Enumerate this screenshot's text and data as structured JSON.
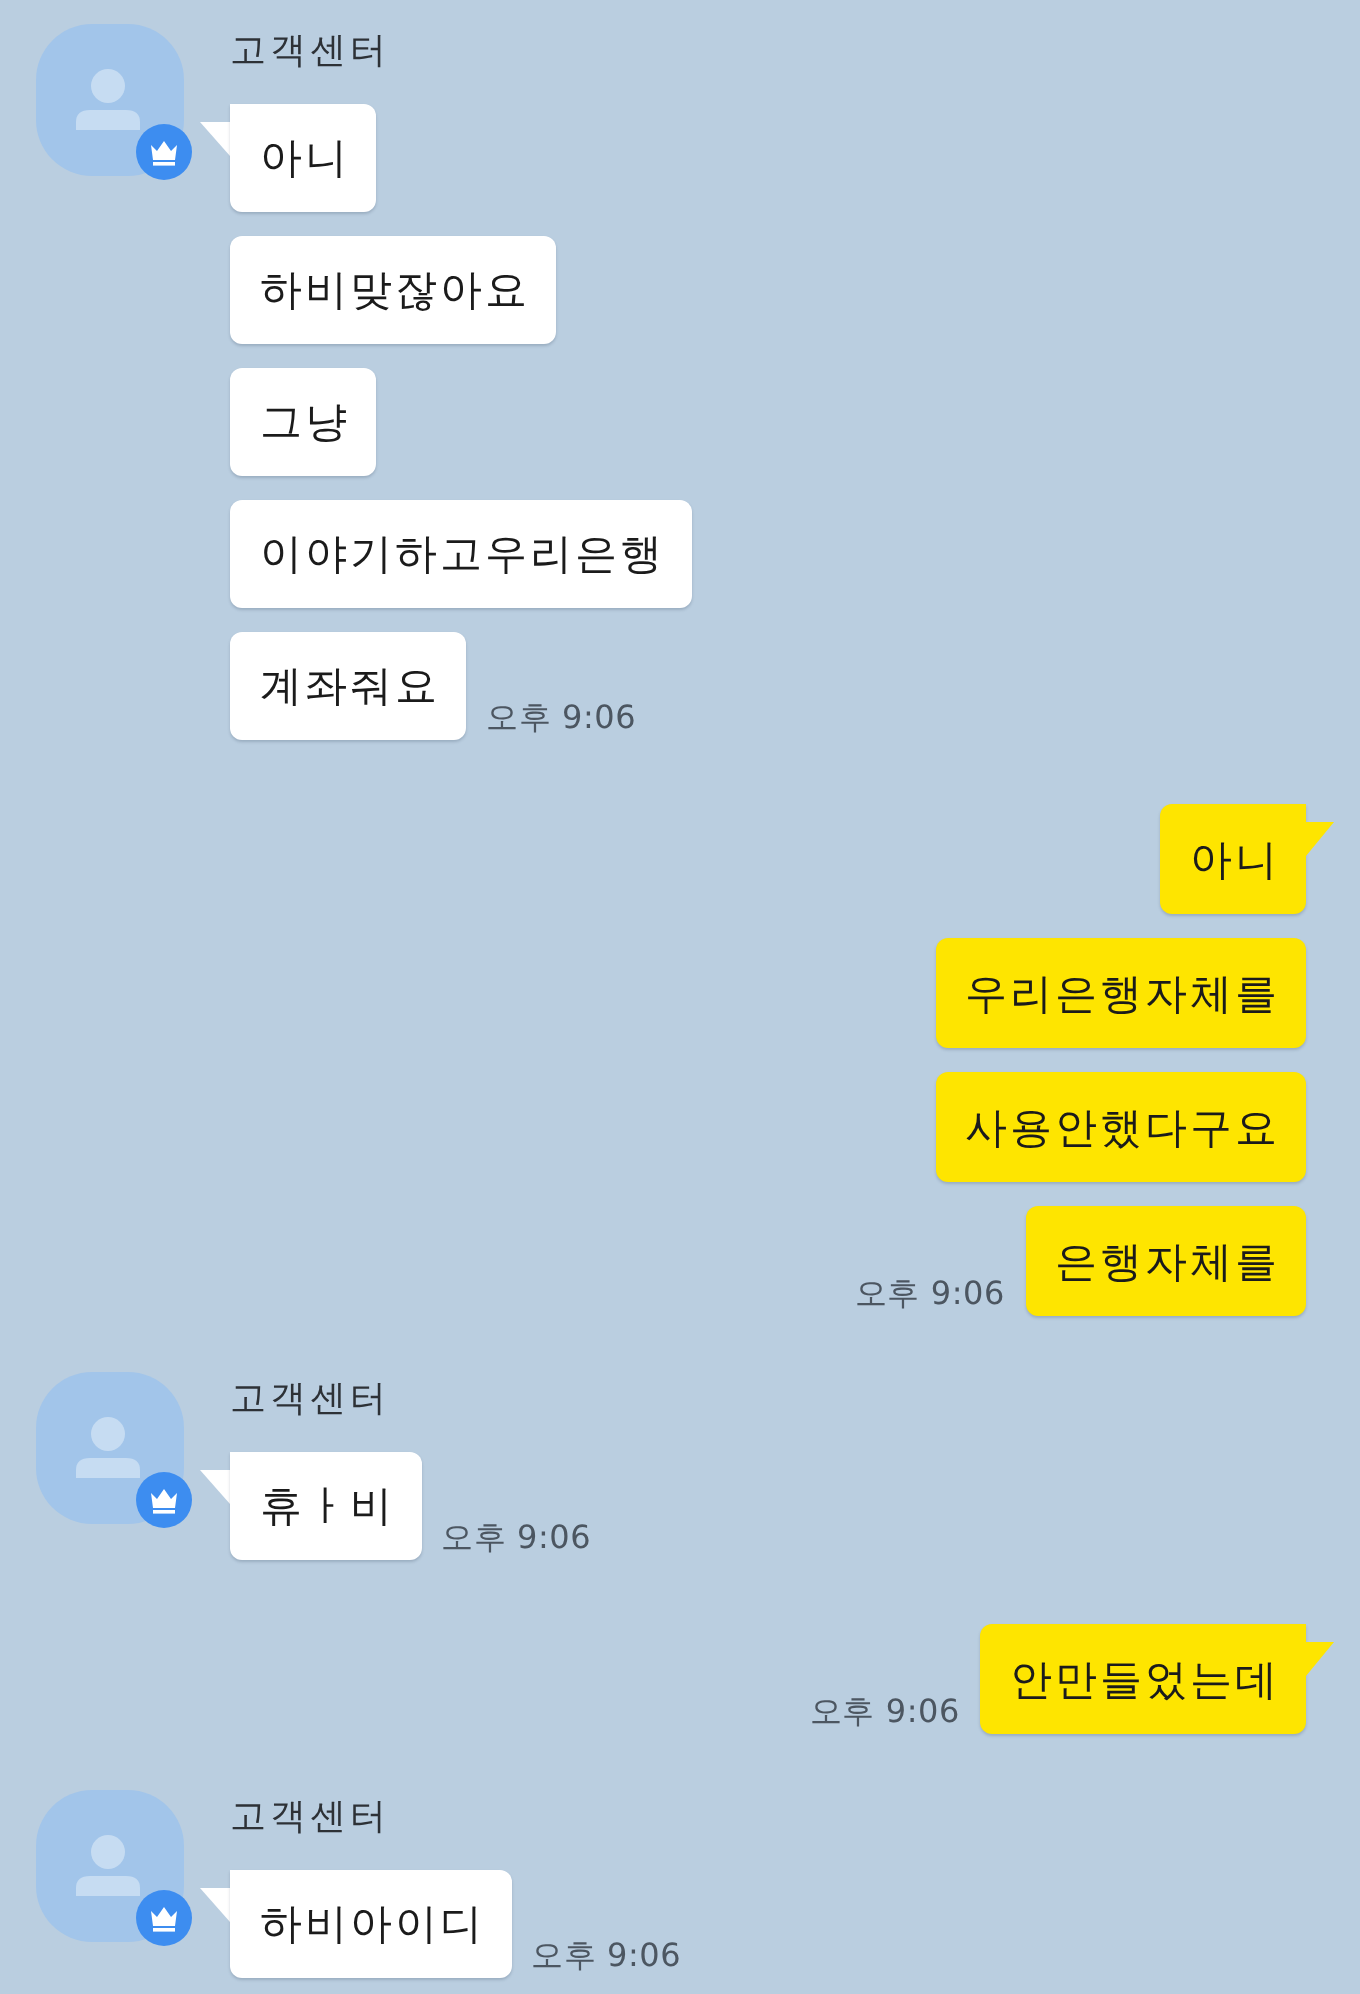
{
  "messages": [
    {
      "kind": "incoming",
      "sender": "고객센터",
      "bubbles": [
        "아니",
        "하비맞잖아요",
        "그냥",
        "이야기하고우리은행",
        "계좌줘요"
      ],
      "time": "오후 9:06"
    },
    {
      "kind": "outgoing",
      "bubbles": [
        "아니",
        "우리은행자체를",
        "사용안했다구요",
        "은행자체를"
      ],
      "time": "오후 9:06"
    },
    {
      "kind": "incoming",
      "sender": "고객센터",
      "bubbles": [
        "휴ㅏ비"
      ],
      "time": "오후 9:06"
    },
    {
      "kind": "outgoing",
      "bubbles": [
        "안만들었는데"
      ],
      "time": "오후 9:06"
    },
    {
      "kind": "incoming",
      "sender": "고객센터",
      "bubbles": [
        "하비아이디"
      ],
      "time": "오후 9:06"
    }
  ]
}
